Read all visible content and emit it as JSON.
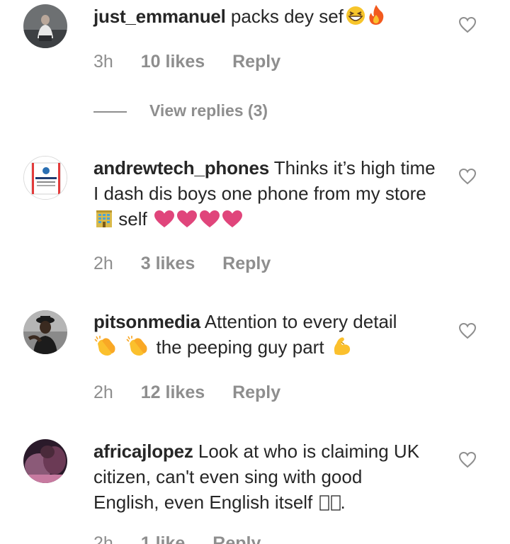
{
  "comments": [
    {
      "username": "just_emmanuel",
      "text": "packs dey sef",
      "time": "3h",
      "likes": "10 likes",
      "reply": "Reply",
      "view_replies": "View replies (3)"
    },
    {
      "username": "andrewtech_phones",
      "text_1": "Thinks it’s high time I dash dis boys one phone from my store",
      "text_2": "self",
      "time": "2h",
      "likes": "3 likes",
      "reply": "Reply",
      "avatar_text": "ANDREWTECH"
    },
    {
      "username": "pitsonmedia",
      "text_1": "Attention to every detail",
      "text_2": "the peeping guy part",
      "time": "2h",
      "likes": "12 likes",
      "reply": "Reply"
    },
    {
      "username": "africajlopez",
      "text": "Look at who is claiming UK citizen, can't even sing with good English, even English itself",
      "text_end": ".",
      "time": "2h",
      "likes": "1 like",
      "reply": "Reply"
    }
  ],
  "icons": {
    "like": "heart-outline-icon",
    "grin": "grinning-squinting-face-icon",
    "fire": "fire-icon",
    "store": "building-icon",
    "heart": "pink-heart-icon",
    "clap": "clapping-hands-icon",
    "muscle": "flexed-biceps-icon"
  },
  "colors": {
    "text": "#262626",
    "muted": "#8e8e8e",
    "heart": "#e0457b"
  }
}
